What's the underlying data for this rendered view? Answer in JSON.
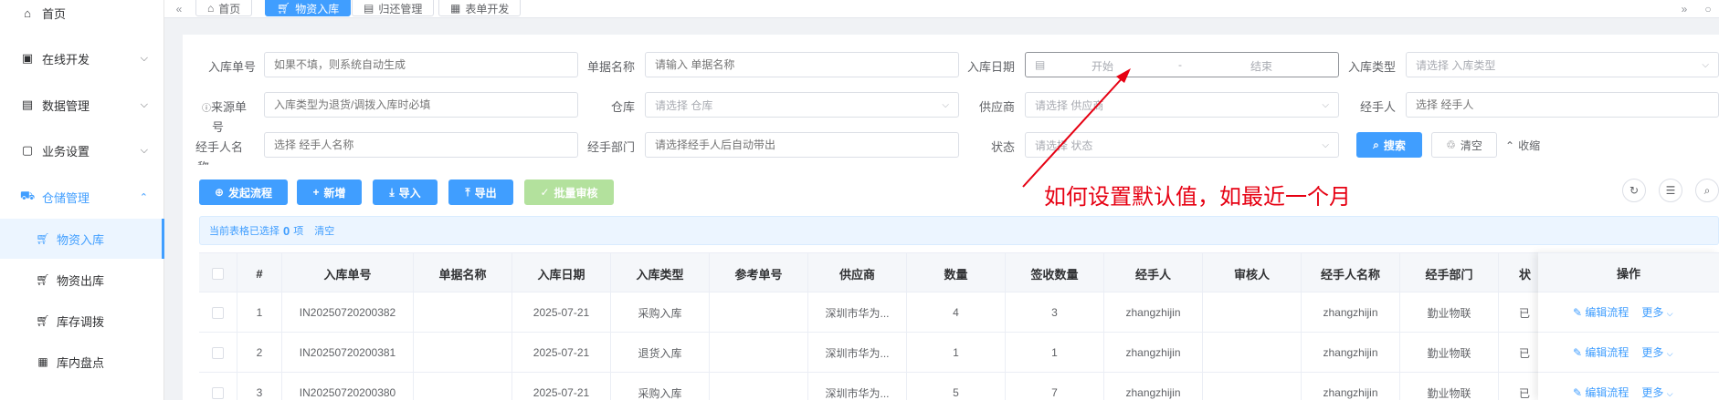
{
  "sidebar": {
    "items": [
      {
        "label": "首页",
        "icon": "home-icon"
      },
      {
        "label": "在线开发",
        "icon": "code-icon"
      },
      {
        "label": "数据管理",
        "icon": "database-icon"
      },
      {
        "label": "业务设置",
        "icon": "briefcase-icon"
      },
      {
        "label": "仓储管理",
        "icon": "truck-icon"
      }
    ],
    "sub_items": [
      {
        "label": "物资入库",
        "icon": "cart-icon"
      },
      {
        "label": "物资出库",
        "icon": "cart-icon"
      },
      {
        "label": "库存调拨",
        "icon": "cart-icon"
      },
      {
        "label": "库内盘点",
        "icon": "calculator-icon"
      }
    ]
  },
  "tabs": [
    {
      "label": "首页",
      "icon": "home-icon"
    },
    {
      "label": "物资入库",
      "icon": "cart-icon"
    },
    {
      "label": "归还管理",
      "icon": "document-icon"
    },
    {
      "label": "表单开发",
      "icon": "form-icon"
    }
  ],
  "filters": {
    "inbound_no": {
      "label": "入库单号",
      "placeholder": "如果不填，则系统自动生成"
    },
    "doc_name": {
      "label": "单据名称",
      "placeholder": "请输入 单据名称"
    },
    "inbound_date": {
      "label": "入库日期",
      "start": "开始",
      "sep": "-",
      "end": "结束"
    },
    "inbound_type": {
      "label": "入库类型",
      "placeholder": "请选择 入库类型"
    },
    "source_doc": {
      "label": "来源单",
      "label_wrap": "号",
      "placeholder": "入库类型为退货/调拨入库时必填"
    },
    "warehouse": {
      "label": "仓库",
      "placeholder": "请选择 仓库"
    },
    "supplier": {
      "label": "供应商",
      "placeholder": "请选择 供应商"
    },
    "handler": {
      "label": "经手人",
      "placeholder": "选择 经手人"
    },
    "handler_name": {
      "label": "经手人名",
      "label_wrap": "称",
      "placeholder": "选择 经手人名称"
    },
    "handler_dept": {
      "label": "经手部门",
      "placeholder": "请选择经手人后自动带出"
    },
    "status": {
      "label": "状态",
      "placeholder": "请选择 状态"
    }
  },
  "actions": {
    "search": "搜索",
    "reset": "清空",
    "collapse": "收缩",
    "start_flow": "发起流程",
    "add": "新增",
    "import": "导入",
    "export": "导出",
    "batch_audit": "批量审核"
  },
  "selection": {
    "prefix": "当前表格已选择",
    "count": "0",
    "suffix": "项",
    "clear": "清空"
  },
  "table": {
    "columns": [
      "#",
      "入库单号",
      "单据名称",
      "入库日期",
      "入库类型",
      "参考单号",
      "供应商",
      "数量",
      "签收数量",
      "经手人",
      "审核人",
      "经手人名称",
      "经手部门",
      "状"
    ],
    "ops_header": "操作",
    "rows": [
      {
        "idx": "1",
        "no": "IN20250720200382",
        "name": "",
        "date": "2025-07-21",
        "type": "采购入库",
        "ref": "",
        "supplier": "深圳市华为...",
        "qty": "4",
        "signed": "3",
        "handler": "zhangzhijin",
        "auditor": "",
        "handler_name": "zhangzhijin",
        "dept": "勤业物联",
        "status": "已"
      },
      {
        "idx": "2",
        "no": "IN20250720200381",
        "name": "",
        "date": "2025-07-21",
        "type": "退货入库",
        "ref": "",
        "supplier": "深圳市华为...",
        "qty": "1",
        "signed": "1",
        "handler": "zhangzhijin",
        "auditor": "",
        "handler_name": "zhangzhijin",
        "dept": "勤业物联",
        "status": "已"
      },
      {
        "idx": "3",
        "no": "IN20250720200380",
        "name": "",
        "date": "2025-07-21",
        "type": "采购入库",
        "ref": "",
        "supplier": "深圳市华为...",
        "qty": "5",
        "signed": "7",
        "handler": "zhangzhijin",
        "auditor": "",
        "handler_name": "zhangzhijin",
        "dept": "勤业物联",
        "status": "已"
      }
    ],
    "row_ops": {
      "edit": "编辑流程",
      "more": "更多"
    }
  },
  "annotation": {
    "text": "如何设置默认值，如最近一个月",
    "color": "#e60012"
  },
  "colors": {
    "primary": "#409eff",
    "disabled_green": "#b3e19d",
    "sidebar_active_bg": "#ecf5ff"
  }
}
